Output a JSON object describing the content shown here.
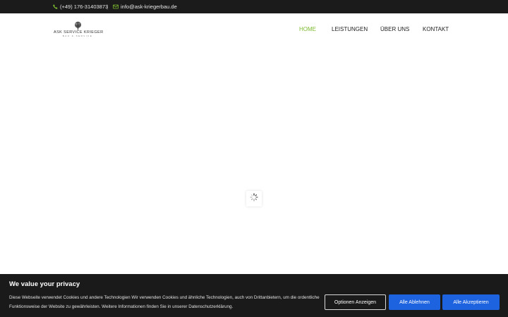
{
  "topbar": {
    "phone": "(+49) 176-31403873",
    "separator": "|",
    "email": "info@ask-kriegerbau.de"
  },
  "logo": {
    "name": "ASK SERVICE KRIEGER",
    "tagline": "BAU & SERVICE"
  },
  "nav": {
    "items": [
      {
        "label": "HOME",
        "active": true
      },
      {
        "label": "LEISTUNGEN",
        "active": false
      },
      {
        "label": "ÜBER UNS",
        "active": false
      },
      {
        "label": "KONTAKT",
        "active": false
      }
    ]
  },
  "cookie": {
    "title": "We value your privacy",
    "text": "Diese Webseite verwendet Cookies und andere Technologien Wir verwenden Cookies und ähnliche Technologien, auch von Drittanbietern, um die ordentliche Funktionsweise der Website zu gewährleisten. Weitere Informationen finden Sie in unserer Datenschutzerklärung.",
    "buttons": {
      "options": "Optionen Anzeigen",
      "reject": "Alle Ablehnen",
      "accept": "Alle Akzeptieren"
    }
  },
  "colors": {
    "accent": "#7dbb2f",
    "topbar_bg": "#1b1b1b",
    "cookie_bg": "#1a1a1a",
    "button_blue": "#1d63e0"
  },
  "icons": {
    "phone": "phone-icon",
    "email": "envelope-icon",
    "loader": "spinner-icon",
    "logo": "tree-icon"
  }
}
